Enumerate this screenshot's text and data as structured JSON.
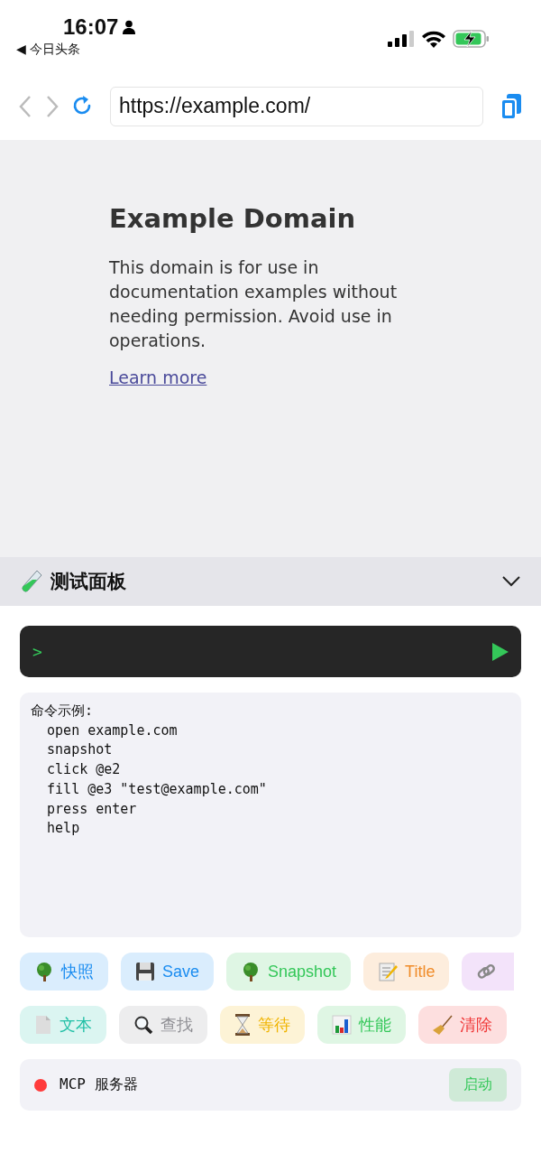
{
  "status_bar": {
    "time": "16:07",
    "back_app": "◀ 今日头条"
  },
  "browser": {
    "url": "https://example.com/"
  },
  "page": {
    "heading": "Example Domain",
    "paragraph": "This domain is for use in documentation examples without needing permission. Avoid use in operations.",
    "link": "Learn more"
  },
  "panel": {
    "title": "测试面板",
    "expanded": true,
    "command": {
      "prompt": ">"
    },
    "output": [
      "命令示例:",
      "  open example.com",
      "  snapshot",
      "  click @e2",
      "  fill @e3 \"test@example.com\"",
      "  press enter",
      "  help"
    ],
    "quick_actions": [
      {
        "kind": "full",
        "label": "快照",
        "color": "#1a8cf0"
      },
      {
        "kind": "full",
        "label": "Save",
        "color": "#1a8cf0"
      },
      {
        "kind": "full",
        "label": "Snapshot",
        "color": "#34c759"
      },
      {
        "kind": "full",
        "label": "Title",
        "color": "#f08c2a"
      },
      {
        "kind": "cut_off"
      }
    ],
    "tools": [
      {
        "label": "文本",
        "color": "#1fbfa5"
      },
      {
        "label": "查找",
        "color": "#8e8e93"
      },
      {
        "label": "等待",
        "color": "#f0b400"
      },
      {
        "label": "性能",
        "color": "#34c759"
      },
      {
        "label": "清除",
        "color": "#f03a3a"
      }
    ],
    "server": {
      "name": "MCP 服务器",
      "running": false,
      "button": "启动"
    }
  }
}
